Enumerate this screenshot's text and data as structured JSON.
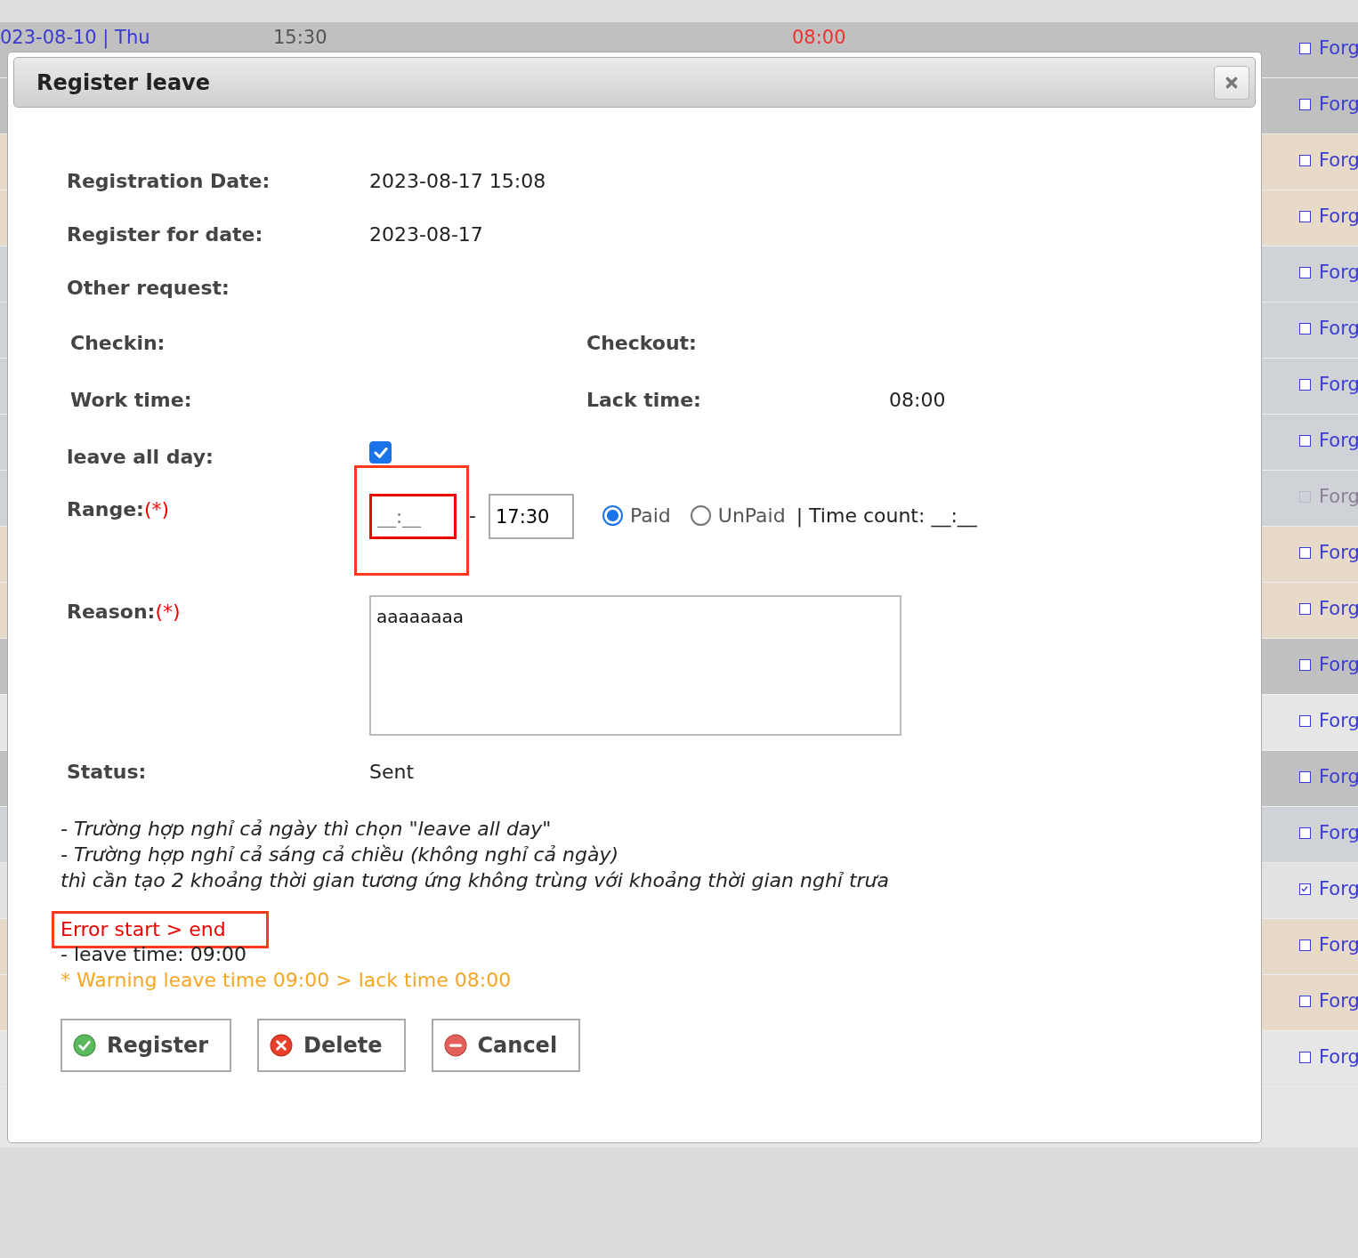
{
  "background_rows": [
    {
      "color": "#c0c0c0",
      "date": "023-08-10 | Thu",
      "time_in": "15:30",
      "lack": "08:00",
      "checked": false,
      "disabled": false,
      "link": "Forg"
    },
    {
      "color": "#c0c0c0",
      "checked": false,
      "disabled": false,
      "link": "Forg"
    },
    {
      "color": "#e8dac8",
      "checked": false,
      "disabled": false,
      "link": "Forg"
    },
    {
      "color": "#e8dac8",
      "checked": false,
      "disabled": false,
      "link": "Forg"
    },
    {
      "color": "#cfd2d6",
      "checked": false,
      "disabled": false,
      "link": "Forg"
    },
    {
      "color": "#cfd2d6",
      "checked": false,
      "disabled": false,
      "link": "Forg"
    },
    {
      "color": "#cfd2d6",
      "checked": false,
      "disabled": false,
      "link": "Forg"
    },
    {
      "color": "#cfd2d6",
      "checked": false,
      "disabled": false,
      "link": "Forg"
    },
    {
      "color": "#cfd2d6",
      "checked": false,
      "disabled": true,
      "link": "Forg"
    },
    {
      "color": "#e8dac8",
      "checked": false,
      "disabled": false,
      "link": "Forg"
    },
    {
      "color": "#e8dac8",
      "checked": false,
      "disabled": false,
      "link": "Forg"
    },
    {
      "color": "#c0c0c0",
      "checked": false,
      "disabled": false,
      "link": "Forg"
    },
    {
      "color": "#e6e6e6",
      "checked": false,
      "disabled": false,
      "link": "Forg"
    },
    {
      "color": "#c0c0c0",
      "checked": false,
      "disabled": false,
      "link": "Forg"
    },
    {
      "color": "#cfd2d6",
      "checked": false,
      "disabled": false,
      "link": "Forg"
    },
    {
      "color": "#e2e2e2",
      "checked": true,
      "disabled": false,
      "link": "Forg"
    },
    {
      "color": "#e8dac8",
      "checked": false,
      "disabled": false,
      "link": "Forg"
    },
    {
      "color": "#e8dac8",
      "checked": false,
      "disabled": false,
      "link": "Forg"
    },
    {
      "color": "#e6e6e6",
      "checked": false,
      "disabled": false,
      "link": "Forg"
    }
  ],
  "dialog": {
    "title": "Register leave",
    "registration_date": {
      "label": "Registration Date:",
      "value": "2023-08-17 15:08"
    },
    "register_for_date": {
      "label": "Register for date:",
      "value": "2023-08-17"
    },
    "other_request": {
      "label": "Other request:"
    },
    "checkin": {
      "label": "Checkin:"
    },
    "checkout": {
      "label": "Checkout:"
    },
    "work_time": {
      "label": "Work time:"
    },
    "lack_time": {
      "label": "Lack time:",
      "value": "08:00"
    },
    "leave_all_day": {
      "label": "leave all day:",
      "checked": true
    },
    "range": {
      "label": "Range:",
      "required_mark": "(*)",
      "start": {
        "placeholder": "__:__",
        "highlighted": true
      },
      "separator": "-",
      "end": {
        "value": "17:30"
      },
      "pay_options": [
        {
          "label": "Paid",
          "selected": true
        },
        {
          "label": "UnPaid",
          "selected": false
        }
      ],
      "time_count": "| Time count: __:__"
    },
    "reason": {
      "label": "Reason:",
      "required_mark": "(*)",
      "value": "aaaaaaaa"
    },
    "status": {
      "label": "Status:",
      "value": "Sent"
    },
    "notes": [
      "- Trường hợp nghỉ cả ngày thì chọn \"leave all day\"",
      "- Trường hợp nghỉ cả sáng cả chiều (không nghỉ cả ngày)",
      "thì cần tạo 2 khoảng thời gian tương ứng không trùng với khoảng thời gian nghỉ trưa"
    ],
    "error": {
      "text": "Error start > end",
      "highlighted": true
    },
    "leave_time": "- leave time: 09:00",
    "warning": "* Warning leave time 09:00 > lack time 08:00",
    "buttons": [
      {
        "label": "Register",
        "kind": "ok"
      },
      {
        "label": "Delete",
        "kind": "delete"
      },
      {
        "label": "Cancel",
        "kind": "cancel"
      }
    ]
  }
}
